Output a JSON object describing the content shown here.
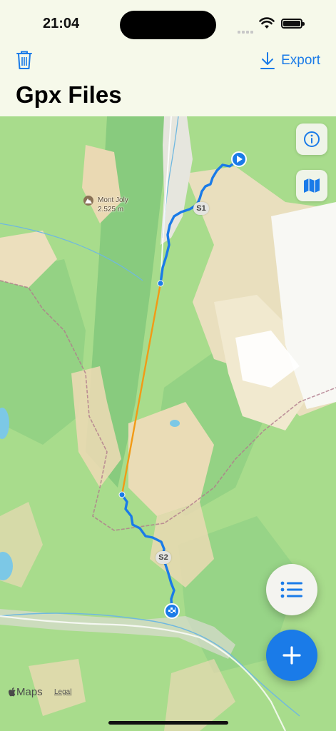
{
  "status_bar": {
    "time": "21:04"
  },
  "header": {
    "export_label": "Export",
    "title": "Gpx Files"
  },
  "map": {
    "poi": {
      "name": "Mont Joly",
      "elevation": "2.525 m"
    },
    "segment_labels": [
      "S1",
      "S2"
    ],
    "attribution": {
      "logo": "Maps",
      "legal": "Legal"
    },
    "colors": {
      "track": "#1a7be8",
      "connector": "#f29a16",
      "accent": "#1a7be8"
    }
  },
  "icons": {
    "trash": "trash-icon",
    "export": "download-icon",
    "info": "info-icon",
    "map_mode": "map-icon",
    "list": "list-icon",
    "add": "plus-icon"
  }
}
